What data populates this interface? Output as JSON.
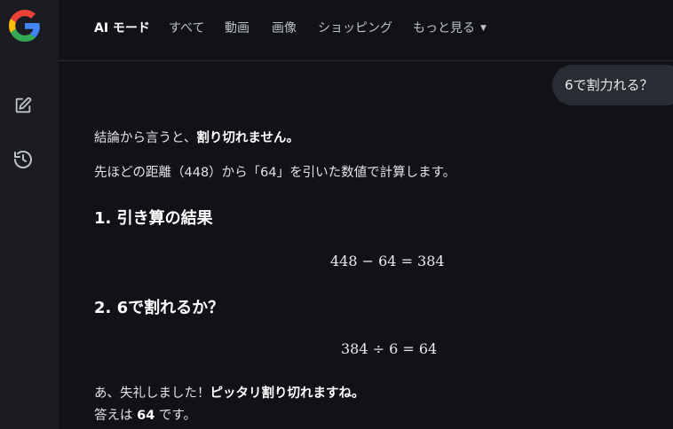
{
  "nav": {
    "tabs": [
      {
        "label": "AI モード",
        "active": true
      },
      {
        "label": "すべて"
      },
      {
        "label": "動画"
      },
      {
        "label": "画像"
      },
      {
        "label": "ショッピング"
      },
      {
        "label": "もっと見る"
      }
    ]
  },
  "sidebar": {
    "icons": [
      "google-logo-icon",
      "edit-icon",
      "history-icon"
    ]
  },
  "user_message": "6で割力れる？",
  "answer": {
    "line1_plain": "結論から言うと、",
    "line1_bold": "割り切れません。",
    "line2": "先ほどの距離（448）から「64」を引いた数値で計算します。",
    "heading1": "1. 引き算の結果",
    "equation1": "448 − 64 = 384",
    "heading2": "2. 6で割れるか？",
    "equation2": "384 ÷ 6 = 64",
    "line3_plain": "あ、失礼しました！",
    "line3_bold": "ピッタリ割り切れますね。",
    "line4_pre": "答えは ",
    "line4_bold": "64",
    "line4_post": " です。"
  },
  "colors": {
    "background": "#101218",
    "rail": "#1b1c22",
    "bubble": "#2a2c33",
    "text": "#e3e3e3",
    "google_blue": "#4285F4",
    "google_red": "#EA4335",
    "google_yellow": "#FBBC05",
    "google_green": "#34A853"
  }
}
